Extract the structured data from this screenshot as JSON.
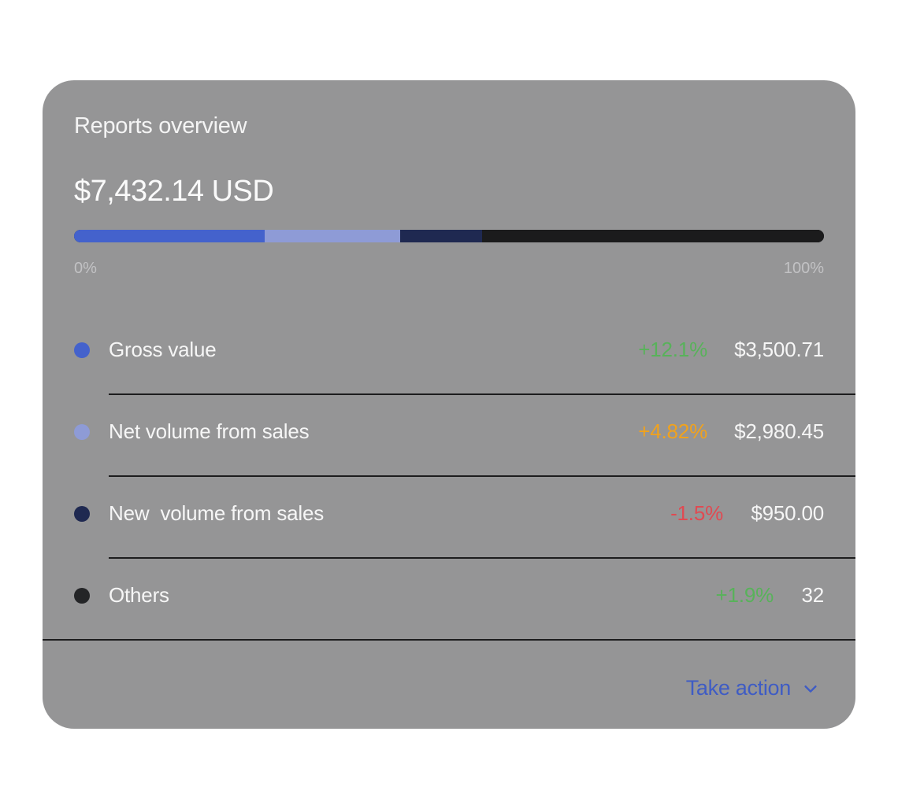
{
  "card": {
    "title": "Reports overview",
    "total": "$7,432.14 USD"
  },
  "progress": {
    "min_label": "0%",
    "max_label": "100%",
    "segments": [
      {
        "name": "Gross value",
        "fraction": 0.254,
        "color": "#4462cc"
      },
      {
        "name": "Net volume from sales",
        "fraction": 0.181,
        "color": "#8e9bd6"
      },
      {
        "name": "New  volume from sales",
        "fraction": 0.109,
        "color": "#1f2951"
      },
      {
        "name": "Others",
        "fraction": 0.456,
        "color": "#1b1b1c"
      }
    ]
  },
  "rows": [
    {
      "label": "Gross value",
      "change": "+12.1%",
      "change_color": "#58b25a",
      "amount": "$3,500.71",
      "dot_color": "#4462cc"
    },
    {
      "label": "Net volume from sales",
      "change": "+4.82%",
      "change_color": "#f1a21c",
      "amount": "$2,980.45",
      "dot_color": "#8e9bd6"
    },
    {
      "label": "New  volume from sales",
      "change": "-1.5%",
      "change_color": "#e04a52",
      "amount": "$950.00",
      "dot_color": "#1f2951"
    },
    {
      "label": "Others",
      "change": "+1.9%",
      "change_color": "#58b25a",
      "amount": "32",
      "dot_color": "#242527"
    }
  ],
  "footer": {
    "action_label": "Take action",
    "action_icon": "chevron-down-icon",
    "accent": "#3f5cc4"
  }
}
